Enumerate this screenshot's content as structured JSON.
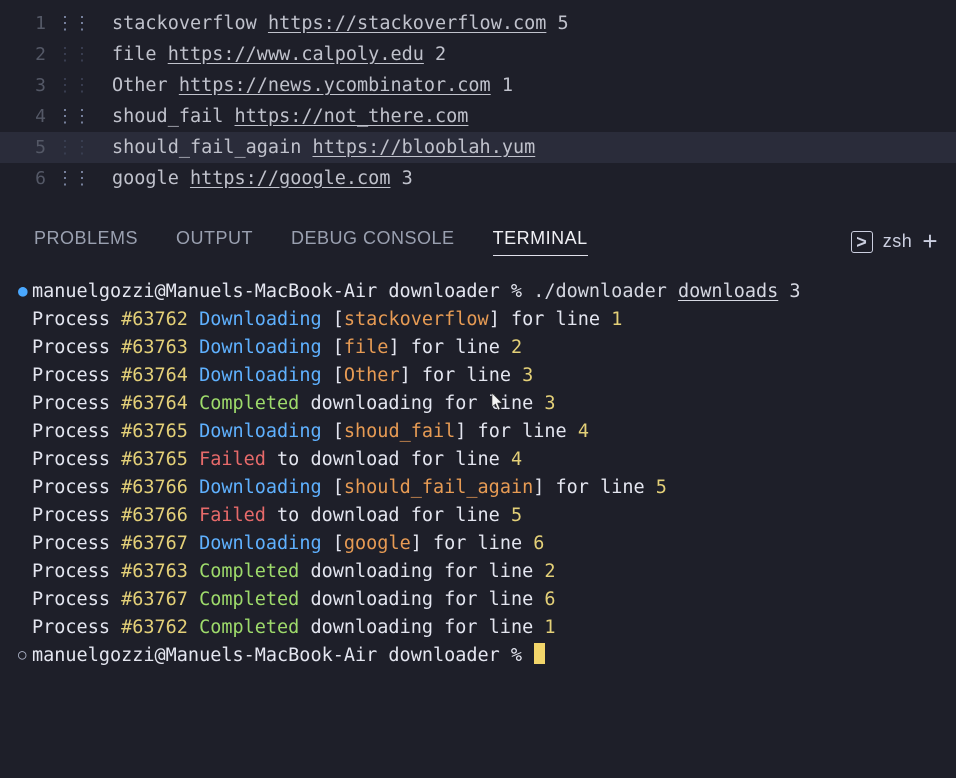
{
  "editor": {
    "lines": [
      {
        "n": "1",
        "name": "stackoverflow",
        "url": "https://stackoverflow.com",
        "suffix": " 5",
        "decor": "light"
      },
      {
        "n": "2",
        "name": "file",
        "url": "https://www.calpoly.edu",
        "suffix": " 2",
        "decor": "dark"
      },
      {
        "n": "3",
        "name": "Other",
        "url": "https://news.ycombinator.com",
        "suffix": " 1",
        "decor": "dark"
      },
      {
        "n": "4",
        "name": "shoud_fail",
        "url": "https://not_there.com",
        "suffix": "",
        "decor": "light"
      },
      {
        "n": "5",
        "name": "should_fail_again",
        "url": "https://blooblah.yum",
        "suffix": "",
        "decor": "dark",
        "highlight": true
      },
      {
        "n": "6",
        "name": "google",
        "url": "https://google.com",
        "suffix": " 3",
        "decor": "light"
      }
    ]
  },
  "tabs": {
    "items": [
      "PROBLEMS",
      "OUTPUT",
      "DEBUG CONSOLE",
      "TERMINAL"
    ],
    "active": 3,
    "shell_label": "zsh"
  },
  "terminal": {
    "prompt": {
      "userhost": "manuelgozzi@Manuels-MacBook-Air",
      "dir": "downloader",
      "symbol": "%"
    },
    "command": {
      "exe": "./downloader",
      "arg_u": "downloads",
      "arg2": "3"
    },
    "lines": [
      {
        "pid": "#63762",
        "status": "Downloading",
        "subject": "stackoverflow",
        "line_no": "1",
        "kind": "start"
      },
      {
        "pid": "#63763",
        "status": "Downloading",
        "subject": "file",
        "line_no": "2",
        "kind": "start"
      },
      {
        "pid": "#63764",
        "status": "Downloading",
        "subject": "Other",
        "line_no": "3",
        "kind": "start"
      },
      {
        "pid": "#63764",
        "status": "Completed",
        "line_no": "3",
        "kind": "done"
      },
      {
        "pid": "#63765",
        "status": "Downloading",
        "subject": "shoud_fail",
        "line_no": "4",
        "kind": "start"
      },
      {
        "pid": "#63765",
        "status": "Failed",
        "line_no": "4",
        "kind": "fail"
      },
      {
        "pid": "#63766",
        "status": "Downloading",
        "subject": "should_fail_again",
        "line_no": "5",
        "kind": "start"
      },
      {
        "pid": "#63766",
        "status": "Failed",
        "line_no": "5",
        "kind": "fail"
      },
      {
        "pid": "#63767",
        "status": "Downloading",
        "subject": "google",
        "line_no": "6",
        "kind": "start"
      },
      {
        "pid": "#63763",
        "status": "Completed",
        "line_no": "2",
        "kind": "done"
      },
      {
        "pid": "#63767",
        "status": "Completed",
        "line_no": "6",
        "kind": "done"
      },
      {
        "pid": "#63762",
        "status": "Completed",
        "line_no": "1",
        "kind": "done"
      }
    ],
    "labels": {
      "process": "Process",
      "brL": "[",
      "brR": "]",
      "for_line": " for line ",
      "downloading_for_line": " downloading for line ",
      "to_download_for_line": " to download for line "
    }
  }
}
